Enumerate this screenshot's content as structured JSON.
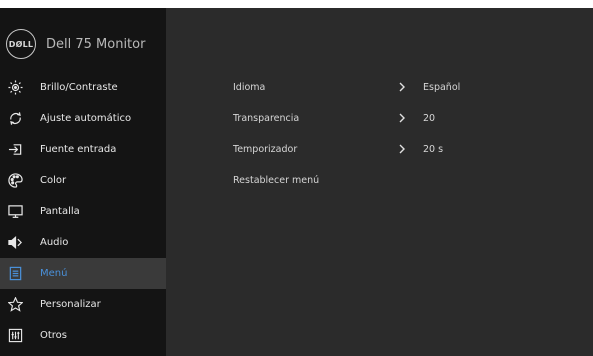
{
  "brand": {
    "logo_text": "DØLL",
    "title": "Dell 75 Monitor"
  },
  "colors": {
    "sidebar_bg": "#141414",
    "panel_bg": "#2b2b2b",
    "active_bg": "#3a3a3a",
    "active_text": "#4a90d9"
  },
  "sidebar": {
    "items": [
      {
        "label": "Brillo/Contraste",
        "icon": "brightness-icon"
      },
      {
        "label": "Ajuste automático",
        "icon": "auto-adjust-icon"
      },
      {
        "label": "Fuente entrada",
        "icon": "input-source-icon"
      },
      {
        "label": "Color",
        "icon": "color-palette-icon"
      },
      {
        "label": "Pantalla",
        "icon": "display-icon"
      },
      {
        "label": "Audio",
        "icon": "speaker-icon"
      },
      {
        "label": "Menú",
        "icon": "menu-icon",
        "active": true
      },
      {
        "label": "Personalizar",
        "icon": "star-icon"
      },
      {
        "label": "Otros",
        "icon": "others-icon"
      }
    ]
  },
  "menu": {
    "rows": [
      {
        "label": "Idioma",
        "value": "Español"
      },
      {
        "label": "Transparencia",
        "value": "20"
      },
      {
        "label": "Temporizador",
        "value": "20 s"
      },
      {
        "label": "Restablecer menú"
      }
    ]
  }
}
